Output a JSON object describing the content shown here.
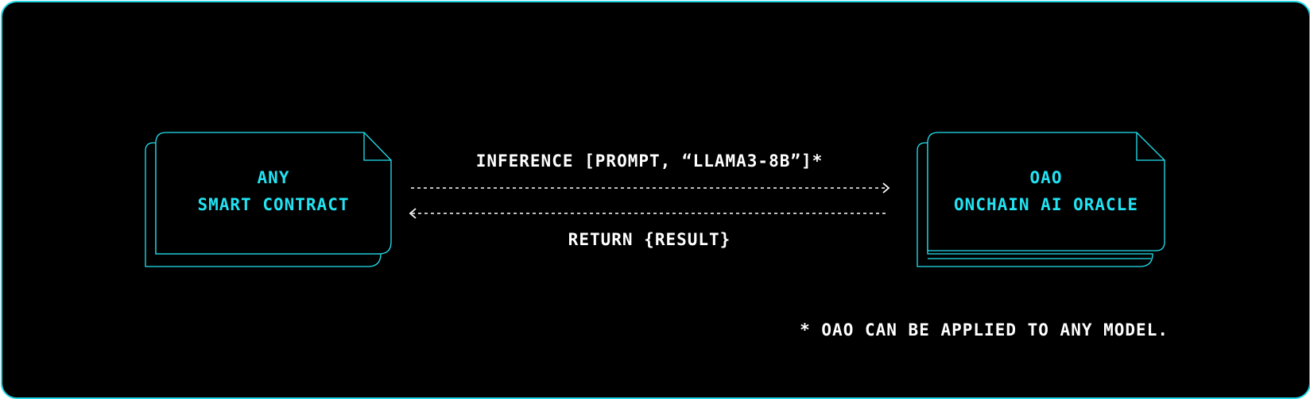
{
  "diagram": {
    "left_node": {
      "line1": "ANY",
      "line2": "SMART CONTRACT"
    },
    "right_node": {
      "line1": "OAO",
      "line2": "ONCHAIN AI ORACLE"
    },
    "request_label": "INFERENCE [PROMPT, “LLAMA3-8B”]*",
    "response_label": "RETURN {RESULT}",
    "footnote": "* OAO CAN BE APPLIED TO ANY MODEL."
  },
  "colors": {
    "background": "#000000",
    "accent": "#22e3f2",
    "text": "#ffffff"
  }
}
